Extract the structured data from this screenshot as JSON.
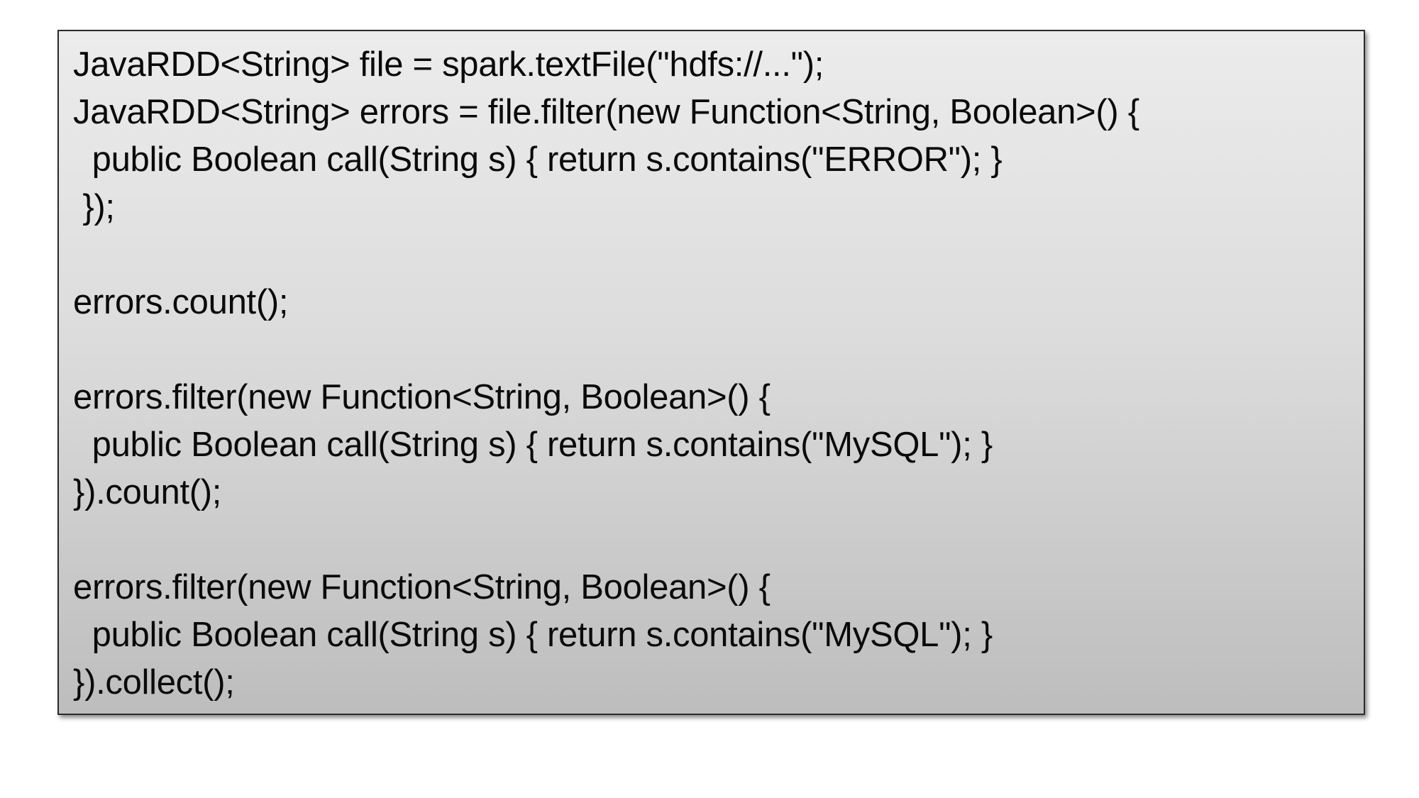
{
  "code": {
    "lines": [
      "JavaRDD<String> file = spark.textFile(\"hdfs://...\");",
      "JavaRDD<String> errors = file.filter(new Function<String, Boolean>() {",
      "  public Boolean call(String s) { return s.contains(\"ERROR\"); }",
      " });",
      "",
      "errors.count();",
      "",
      "errors.filter(new Function<String, Boolean>() {",
      "  public Boolean call(String s) { return s.contains(\"MySQL\"); }",
      "}).count();",
      "",
      "errors.filter(new Function<String, Boolean>() {",
      "  public Boolean call(String s) { return s.contains(\"MySQL\"); }",
      "}).collect();"
    ]
  },
  "colors": {
    "box_top": "#ececec",
    "box_bottom": "#bdbdbd",
    "box_border": "#2b2b2b",
    "text": "#0a0a0a"
  }
}
